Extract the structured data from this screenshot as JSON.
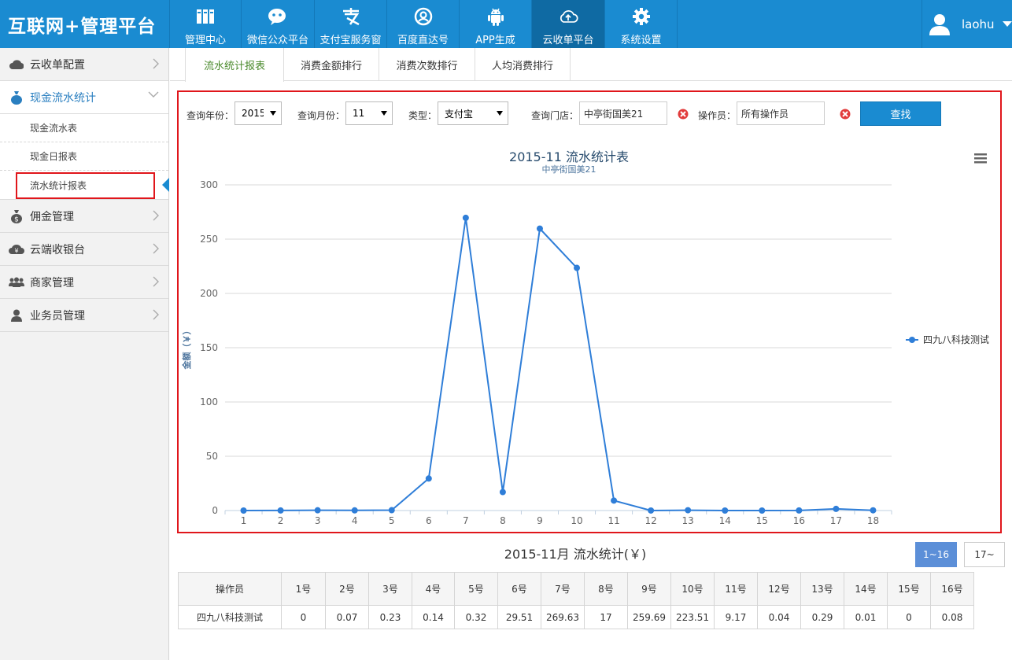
{
  "header": {
    "logo": "互联网+管理平台",
    "nav": [
      {
        "label": "管理中心",
        "icon": "books-icon"
      },
      {
        "label": "微信公众平台",
        "icon": "wechat-icon"
      },
      {
        "label": "支付宝服务窗",
        "icon": "alipay-icon"
      },
      {
        "label": "百度直达号",
        "icon": "baidu-icon"
      },
      {
        "label": "APP生成",
        "icon": "android-icon"
      },
      {
        "label": "云收单平台",
        "icon": "cloud-upload-icon",
        "active": true
      },
      {
        "label": "系统设置",
        "icon": "gear-icon"
      }
    ],
    "user": {
      "name": "laohu"
    }
  },
  "sidebar": {
    "groups": [
      {
        "label": "云收单配置",
        "icon": "cloud-icon"
      },
      {
        "label": "现金流水统计",
        "icon": "money-bag-icon",
        "open": true
      },
      {
        "label": "佣金管理",
        "icon": "dollar-bag-icon"
      },
      {
        "label": "云端收银台",
        "icon": "yen-cloud-icon"
      },
      {
        "label": "商家管理",
        "icon": "users-icon"
      },
      {
        "label": "业务员管理",
        "icon": "user-icon"
      }
    ],
    "sub_items": [
      "现金流水表",
      "现金日报表",
      "流水统计报表"
    ]
  },
  "tabs": [
    "流水统计报表",
    "消费金额排行",
    "消费次数排行",
    "人均消费排行"
  ],
  "filters": {
    "year_label": "查询年份：",
    "year_value": "2015",
    "month_label": "查询月份：",
    "month_value": "11",
    "type_label": "类型：",
    "type_value": "支付宝",
    "store_label": "查询门店：",
    "store_value": "中亭街国美21",
    "operator_label": "操作员：",
    "operator_value": "所有操作员",
    "search_label": "查找"
  },
  "chart_data": {
    "type": "line",
    "title": "2015-11 流水统计表",
    "subtitle": "中亭街国美21",
    "ylabel": "金额（￥）",
    "xlabel": "",
    "x": [
      1,
      2,
      3,
      4,
      5,
      6,
      7,
      8,
      9,
      10,
      11,
      12,
      13,
      14,
      15,
      16,
      17,
      18
    ],
    "ylim": [
      0,
      300
    ],
    "yticks": [
      0,
      50,
      100,
      150,
      200,
      250,
      300
    ],
    "grid": true,
    "legend_position": "right",
    "series": [
      {
        "name": "四九八科技测试",
        "color": "#2f7ed8",
        "values": [
          0,
          0.07,
          0.23,
          0.14,
          0.32,
          29.51,
          269.63,
          17,
          259.69,
          223.51,
          9.17,
          0.04,
          0.29,
          0.01,
          0,
          0.08,
          1.5,
          0.2
        ]
      }
    ]
  },
  "table": {
    "title": "2015-11月 流水统计(￥)",
    "pager": [
      "1~16",
      "17~"
    ],
    "headers": [
      "操作员",
      "1号",
      "2号",
      "3号",
      "4号",
      "5号",
      "6号",
      "7号",
      "8号",
      "9号",
      "10号",
      "11号",
      "12号",
      "13号",
      "14号",
      "15号",
      "16号"
    ],
    "rows": [
      [
        "四九八科技测试",
        "0",
        "0.07",
        "0.23",
        "0.14",
        "0.32",
        "29.51",
        "269.63",
        "17",
        "259.69",
        "223.51",
        "9.17",
        "0.04",
        "0.29",
        "0.01",
        "0",
        "0.08"
      ]
    ]
  }
}
